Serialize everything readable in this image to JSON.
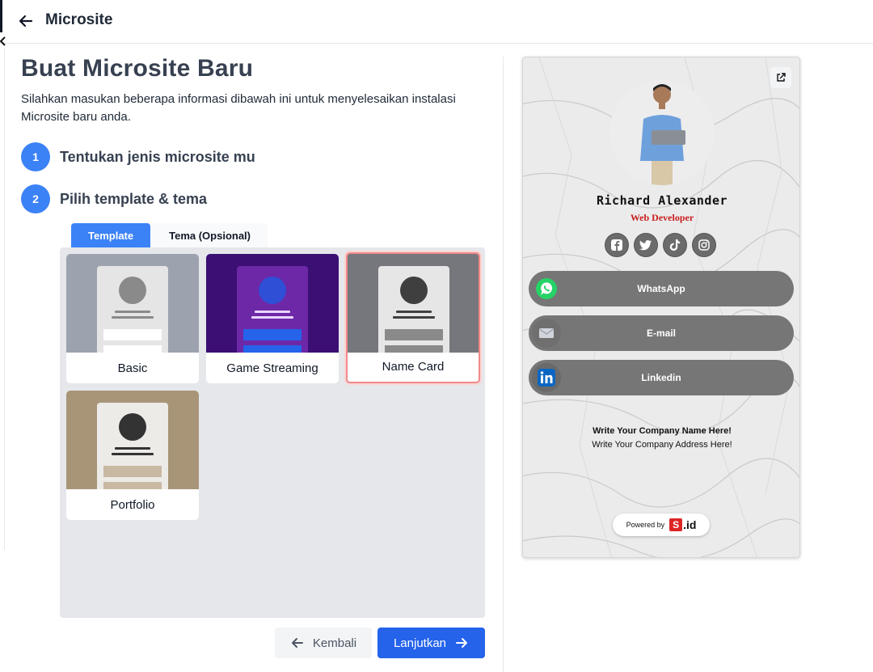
{
  "header": {
    "title": "Microsite"
  },
  "page": {
    "title": "Buat Microsite Baru",
    "description": "Silahkan masukan beberapa informasi dibawah ini untuk menyelesaikan instalasi Microsite baru anda."
  },
  "steps": [
    {
      "number": "1",
      "label": "Tentukan jenis microsite mu"
    },
    {
      "number": "2",
      "label": "Pilih template & tema"
    }
  ],
  "tabs": [
    {
      "label": "Template",
      "active": true
    },
    {
      "label": "Tema (Opsional)",
      "active": false
    }
  ],
  "templates": [
    {
      "label": "Basic",
      "selected": false
    },
    {
      "label": "Game Streaming",
      "selected": false
    },
    {
      "label": "Name Card",
      "selected": true
    },
    {
      "label": "Portfolio",
      "selected": false
    }
  ],
  "actions": {
    "back_label": "Kembali",
    "next_label": "Lanjutkan"
  },
  "preview": {
    "name": "Richard Alexander",
    "role": "Web Developer",
    "socials": [
      "facebook-icon",
      "twitter-icon",
      "tiktok-icon",
      "instagram-icon"
    ],
    "links": [
      {
        "label": "WhatsApp",
        "icon": "whatsapp-icon"
      },
      {
        "label": "E-mail",
        "icon": "email-icon"
      },
      {
        "label": "Linkedin",
        "icon": "linkedin-icon"
      }
    ],
    "company": "Write Your Company Name Here!",
    "address": "Write Your Company Address Here!",
    "powered_label": "Powered by",
    "brand_s": "S",
    "brand_id": ".id"
  },
  "colors": {
    "primary": "#3b82f6",
    "primary_dark": "#2563eb",
    "selected_border": "#f08a8a",
    "role_red": "#c81e1e",
    "link_button": "#767676"
  }
}
